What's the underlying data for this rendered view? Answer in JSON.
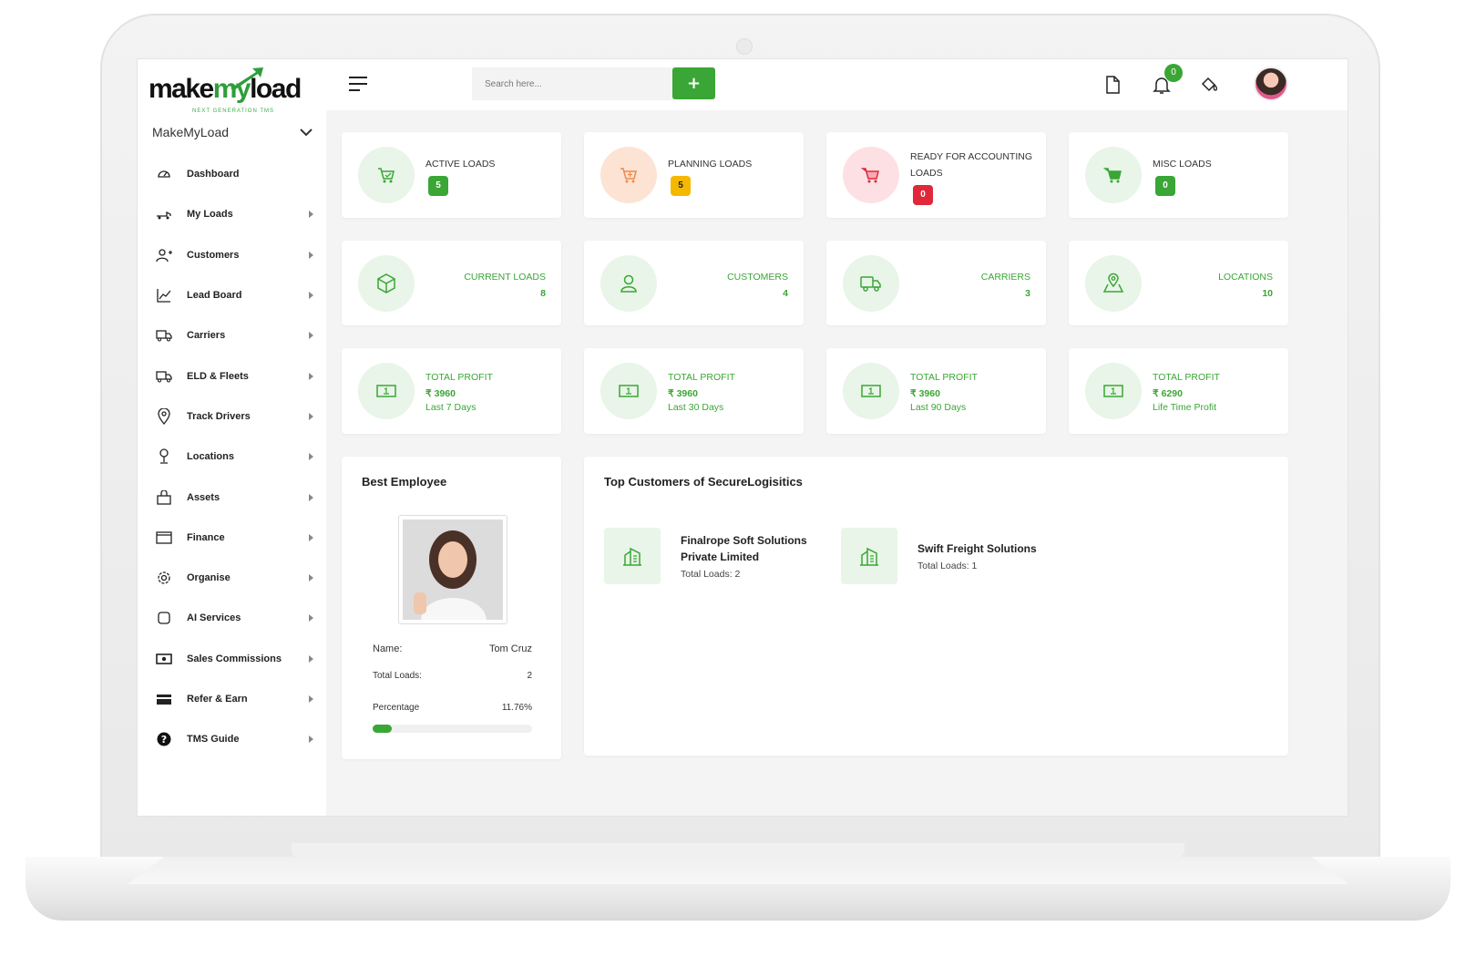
{
  "brand": {
    "logo_make": "make",
    "logo_my": "my",
    "logo_load": "load",
    "logo_tagline": "NEXT GENERATION TMS",
    "company": "MakeMyLoad",
    "accent": "#3aa635"
  },
  "header": {
    "search_placeholder": "Search here...",
    "add_label": "+",
    "notification_count": "0"
  },
  "sidebar": {
    "items": [
      {
        "label": "Dashboard",
        "icon": "gauge-icon"
      },
      {
        "label": "My Loads",
        "icon": "truck-icon"
      },
      {
        "label": "Customers",
        "icon": "user-plus-icon"
      },
      {
        "label": "Lead Board",
        "icon": "chart-line-icon"
      },
      {
        "label": "Carriers",
        "icon": "truck-icon"
      },
      {
        "label": "ELD & Fleets",
        "icon": "truck-icon"
      },
      {
        "label": "Track Drivers",
        "icon": "map-pin-icon"
      },
      {
        "label": "Locations",
        "icon": "location-icon"
      },
      {
        "label": "Assets",
        "icon": "bag-icon"
      },
      {
        "label": "Finance",
        "icon": "card-icon"
      },
      {
        "label": "Organise",
        "icon": "gear-icon"
      },
      {
        "label": "AI Services",
        "icon": "square-icon"
      },
      {
        "label": "Sales Commissions",
        "icon": "cash-icon"
      },
      {
        "label": "Refer & Earn",
        "icon": "wallet-icon"
      },
      {
        "label": "TMS Guide",
        "icon": "help-icon"
      }
    ]
  },
  "kpis": [
    {
      "title": "ACTIVE LOADS",
      "count": "5",
      "color": "#3aa635"
    },
    {
      "title": "PLANNING LOADS",
      "count": "5",
      "color": "#f5b800"
    },
    {
      "title_line1": "READY FOR ACCOUNTING",
      "title_line2": "LOADS",
      "count": "0",
      "color": "#e0283a"
    },
    {
      "title": "MISC LOADS",
      "count": "0",
      "color": "#3aa635"
    }
  ],
  "stats": [
    {
      "label": "CURRENT LOADS",
      "value": "8"
    },
    {
      "label": "CUSTOMERS",
      "value": "4"
    },
    {
      "label": "CARRIERS",
      "value": "3"
    },
    {
      "label": "LOCATIONS",
      "value": "10"
    }
  ],
  "profits": [
    {
      "title": "TOTAL PROFIT",
      "value": "₹ 3960",
      "period": "Last 7 Days"
    },
    {
      "title": "TOTAL PROFIT",
      "value": "₹ 3960",
      "period": "Last 30 Days"
    },
    {
      "title": "TOTAL PROFIT",
      "value": "₹ 3960",
      "period": "Last 90 Days"
    },
    {
      "title": "TOTAL PROFIT",
      "value": "₹ 6290",
      "period": "Life Time Profit"
    }
  ],
  "best_employee": {
    "title": "Best Employee",
    "name_label": "Name:",
    "name": "Tom Cruz",
    "loads_label": "Total Loads:",
    "loads": "2",
    "percentage_label": "Percentage",
    "percentage": "11.76%",
    "progress_fraction": 0.1176
  },
  "top_customers": {
    "title": "Top Customers of SecureLogisitics",
    "items": [
      {
        "name_line1": "Finalrope Soft Solutions",
        "name_line2": "Private Limited",
        "loads": "Total Loads: 2"
      },
      {
        "name_line1": "Swift Freight Solutions",
        "name_line2": "",
        "loads": "Total Loads: 1"
      }
    ]
  }
}
